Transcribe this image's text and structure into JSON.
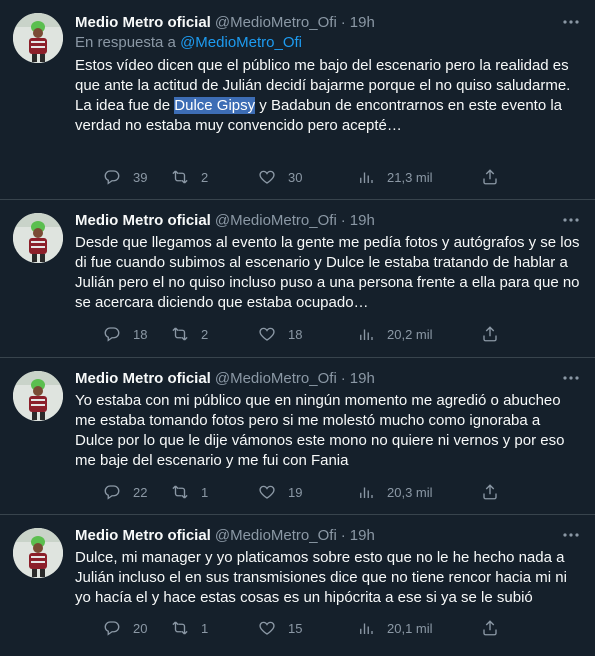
{
  "colors": {
    "background": "#15202b",
    "text": "#f7f9f9",
    "muted": "#8b98a5",
    "link": "#1d9bf0",
    "highlight": "#3d6db5"
  },
  "tweets": [
    {
      "name": "Medio Metro oficial",
      "handle": "@MedioMetro_Ofi",
      "dot": "·",
      "time": "19h",
      "reply_prefix": "En respuesta a ",
      "reply_handle": "@MedioMetro_Ofi",
      "text_a": "Estos vídeo dicen que el público me bajo del escenario pero la realidad es que ante la actitud de Julián decidí bajarme porque el no quiso saludarme.\nLa idea fue de ",
      "text_highlight": "Dulce Gipsy",
      "text_b": " y Badabun de encontrarnos en este evento la verdad no estaba muy convencido pero acepté…",
      "replies": "39",
      "retweets": "2",
      "likes": "30",
      "views": "21,3 mil"
    },
    {
      "name": "Medio Metro oficial",
      "handle": "@MedioMetro_Ofi",
      "dot": "·",
      "time": "19h",
      "text": "Desde que llegamos al evento la gente me pedía fotos y autógrafos y se los di fue cuando subimos al escenario y Dulce le estaba tratando de hablar a Julián pero el no quiso incluso puso a una persona frente a ella para que no se acercara diciendo que estaba ocupado…",
      "replies": "18",
      "retweets": "2",
      "likes": "18",
      "views": "20,2 mil"
    },
    {
      "name": "Medio Metro oficial",
      "handle": "@MedioMetro_Ofi",
      "dot": "·",
      "time": "19h",
      "text": "Yo estaba con mi público que en ningún momento me agredió o abucheo me estaba tomando fotos pero si me molestó mucho como ignoraba a Dulce por lo que le dije vámonos este mono no quiere ni vernos y por eso me baje del escenario y me fui con Fania",
      "replies": "22",
      "retweets": "1",
      "likes": "19",
      "views": "20,3 mil"
    },
    {
      "name": "Medio Metro oficial",
      "handle": "@MedioMetro_Ofi",
      "dot": "·",
      "time": "19h",
      "text": "Dulce, mi manager y yo platicamos sobre esto que no le he hecho nada a Julián incluso el en sus transmisiones dice que no tiene rencor hacia mi ni yo hacía el y hace estas cosas es un hipócrita a ese si ya se le subió",
      "replies": "20",
      "retweets": "1",
      "likes": "15",
      "views": "20,1 mil"
    }
  ]
}
